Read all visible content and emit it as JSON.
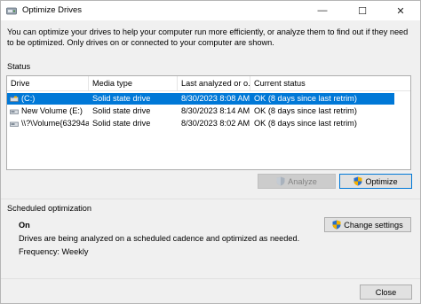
{
  "window": {
    "title": "Optimize Drives",
    "minimize_glyph": "—",
    "maximize_glyph": "☐",
    "close_glyph": "✕"
  },
  "intro_text": "You can optimize your drives to help your computer run more efficiently, or analyze them to find out if they need to be optimized. Only drives on or connected to your computer are shown.",
  "status": {
    "label": "Status",
    "columns": [
      "Drive",
      "Media type",
      "Last analyzed or o...",
      "Current status"
    ],
    "rows": [
      {
        "drive": "(C:)",
        "media": "Solid state drive",
        "date": "8/30/2023 8:08 AM",
        "status": "OK (8 days since last retrim)",
        "selected": true
      },
      {
        "drive": "New Volume (E:)",
        "media": "Solid state drive",
        "date": "8/30/2023 8:14 AM",
        "status": "OK (8 days since last retrim)",
        "selected": false
      },
      {
        "drive": "\\\\?\\Volume{63294a...",
        "media": "Solid state drive",
        "date": "8/30/2023 8:02 AM",
        "status": "OK (8 days since last retrim)",
        "selected": false
      }
    ],
    "analyze_label": "Analyze",
    "optimize_label": "Optimize"
  },
  "scheduled": {
    "label": "Scheduled optimization",
    "state": "On",
    "description": "Drives are being analyzed on a scheduled cadence and optimized as needed.",
    "frequency": "Frequency: Weekly",
    "change_label": "Change settings"
  },
  "footer": {
    "close_label": "Close"
  },
  "colors": {
    "selection": "#0078d7",
    "window_bg": "#f0f0f0",
    "list_bg": "#ffffff"
  }
}
